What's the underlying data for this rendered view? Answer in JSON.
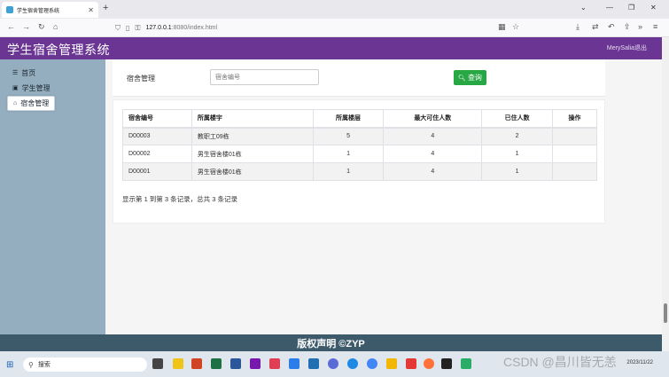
{
  "browser": {
    "tab_title": "学生宿舍管理系统",
    "tab_close": "✕",
    "new_tab": "+",
    "url_host": "127.0.0.1",
    "url_rest": ":8080/index.html"
  },
  "app": {
    "title": "学生宿舍管理系统",
    "user_text": "MerySalia退出"
  },
  "sidebar": {
    "items": [
      {
        "label": "首页",
        "icon": "bars-icon"
      },
      {
        "label": "学生管理",
        "icon": "user-icon"
      },
      {
        "label": "宿舍管理",
        "icon": "home-icon",
        "active": true
      }
    ]
  },
  "search": {
    "label": "宿舍管理",
    "placeholder": "宿舍编号",
    "button": "查询"
  },
  "table": {
    "headers": [
      "宿舍编号",
      "所属楼宇",
      "所属楼层",
      "最大可住人数",
      "已住人数",
      "操作"
    ],
    "rows": [
      [
        "D00003",
        "教职工09栋",
        "5",
        "4",
        "2",
        ""
      ],
      [
        "D00002",
        "男生宿舍楼01栋",
        "1",
        "4",
        "1",
        ""
      ],
      [
        "D00001",
        "男生宿舍楼01栋",
        "1",
        "4",
        "1",
        ""
      ]
    ]
  },
  "pagination": {
    "text": "显示第 1 到第 3 条记录，总共 3 条记录"
  },
  "footer": {
    "text": "版权声明 ©ZYP"
  },
  "taskbar": {
    "search_label": "搜索",
    "date": "2023/11/22"
  },
  "watermark": "CSDN @昌川皆无恙",
  "colors": {
    "header": "#6a3593",
    "sidebar": "#94aebf",
    "footer": "#3d5a6b",
    "search_button": "#28a745"
  }
}
